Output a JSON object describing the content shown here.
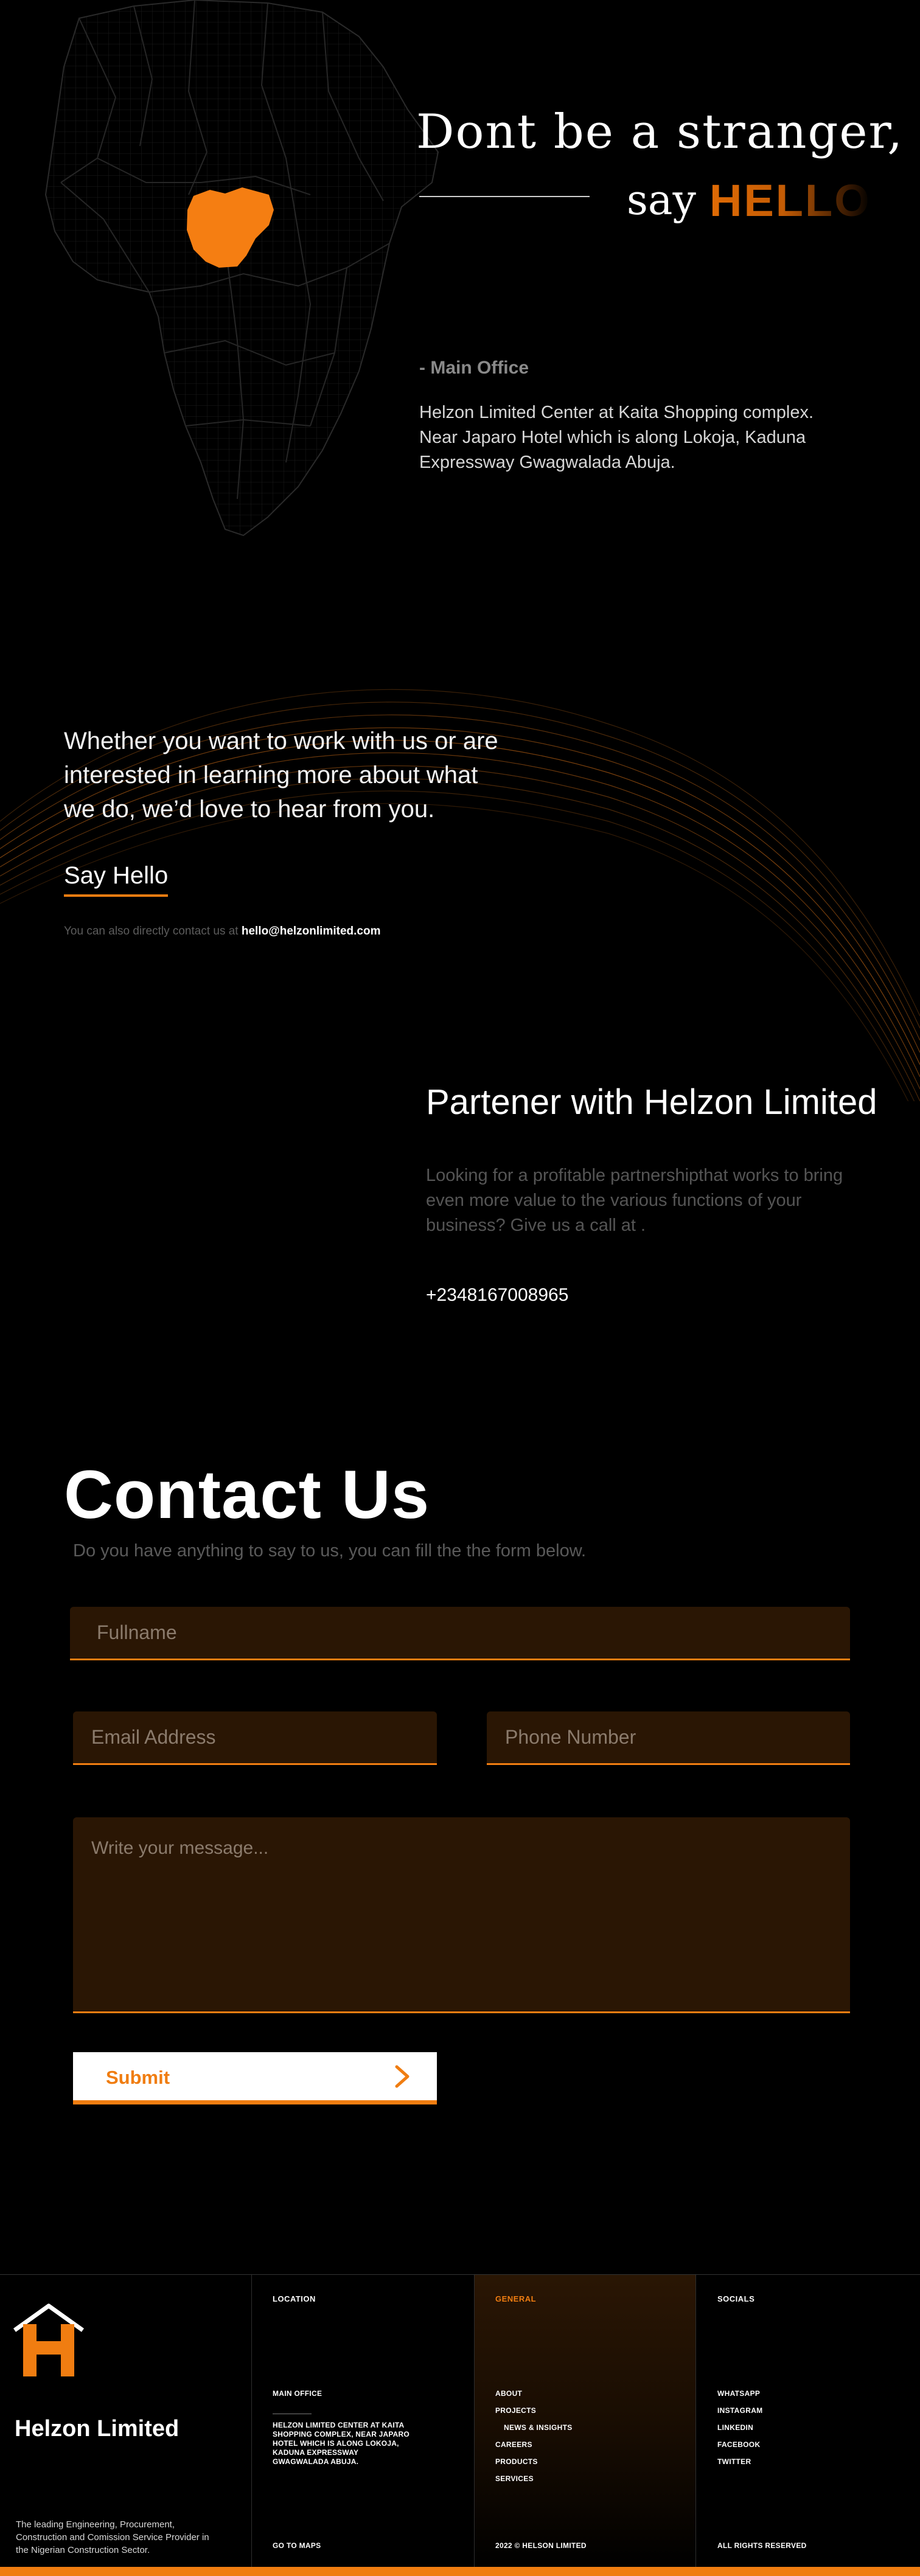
{
  "hero": {
    "title": "Dont be a stranger,",
    "say": "say",
    "hello": "HELLO",
    "office_label": "-  Main Office",
    "office_address": "Helzon Limited Center at Kaita Shopping complex. Near Japaro Hotel which is along Lokoja, Kaduna Expressway Gwagwalada Abuja.",
    "highlight_color": "#f57e12"
  },
  "hello_section": {
    "intro": "Whether you want to work with us or are interested in learning more about what we do, we’d love to  hear from you.",
    "say_hello": "Say Hello",
    "direct_prefix": "You can also directly contact us at ",
    "direct_email": "hello@helzonlimited.com"
  },
  "partner": {
    "title": "Partener with Helzon Limited",
    "text": "Looking for a profitable partnershipthat works to bring even more value to the various functions of your business? Give us a call at .",
    "phone": "+2348167008965"
  },
  "contact": {
    "title": "Contact Us",
    "subtitle": "Do you have anything to say to us, you can fill the the form below.",
    "fullname_placeholder": "Fullname",
    "email_placeholder": "Email Address",
    "phone_placeholder": "Phone Number",
    "message_placeholder": "Write your message...",
    "submit_label": "Submit",
    "accent": "#f07d11"
  },
  "footer": {
    "brand": "Helzon Limited",
    "tagline": "The leading Engineering, Procurement, Construction and Comission Service Provider in the Nigerian Construction Sector.",
    "location": {
      "heading": "LOCATION",
      "sub_heading": "MAIN OFFICE",
      "address": "HELZON LIMITED CENTER AT KAITA SHOPPING COMPLEX, NEAR JAPARO HOTEL WHICH IS ALONG LOKOJA, KADUNA EXPRESSWAY GWAGWALADA ABUJA.",
      "maps_link": "GO TO MAPS"
    },
    "general": {
      "heading": "GENERAL",
      "links": [
        "ABOUT",
        "PROJECTS",
        "NEWS & INSIGHTS",
        "CAREERS",
        "PRODUCTS",
        "SERVICES"
      ],
      "copyright": "2022 © HELSON LIMITED"
    },
    "socials": {
      "heading": "SOCIALS",
      "links": [
        "WHATSAPP",
        "INSTAGRAM",
        "LINKEDIN",
        "FACEBOOK",
        "TWITTER"
      ],
      "rights": "ALL RIGHTS RESERVED"
    }
  }
}
